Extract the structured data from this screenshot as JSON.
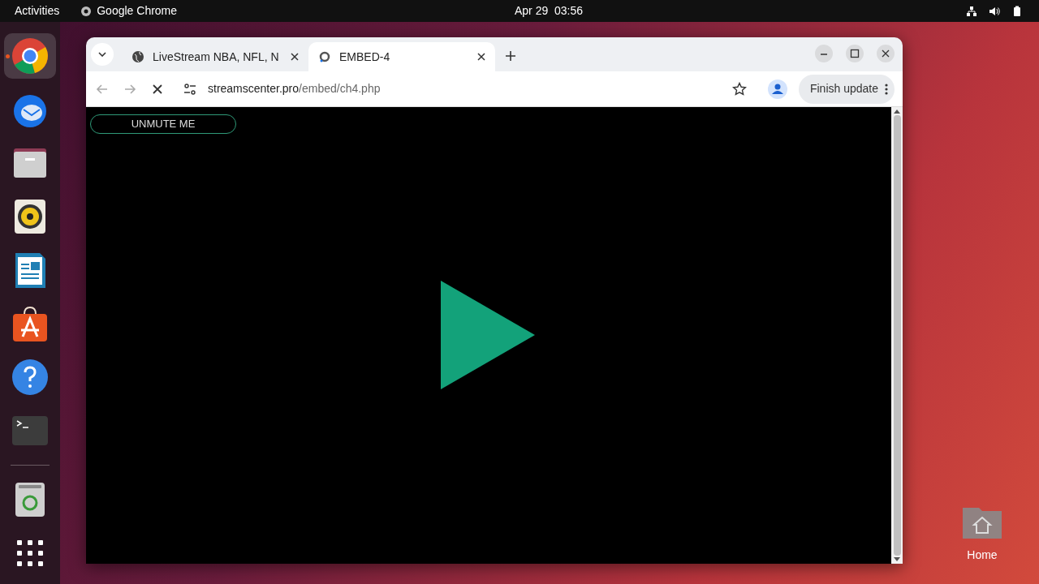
{
  "top_bar": {
    "activities": "Activities",
    "app_name": "Google Chrome",
    "clock": "Apr 29  03:56"
  },
  "dock": {
    "items": [
      {
        "kind": "chrome",
        "selected": true,
        "running": true
      },
      {
        "kind": "thunderbird",
        "selected": false,
        "running": false
      },
      {
        "kind": "files",
        "selected": false,
        "running": false
      },
      {
        "kind": "rhythmbox",
        "selected": false,
        "running": false
      },
      {
        "kind": "writer",
        "selected": false,
        "running": false
      },
      {
        "kind": "software",
        "selected": false,
        "running": false
      },
      {
        "kind": "help",
        "selected": false,
        "running": false
      },
      {
        "kind": "terminal",
        "selected": false,
        "running": false
      },
      {
        "kind": "separator"
      },
      {
        "kind": "trash",
        "selected": false,
        "running": false
      },
      {
        "kind": "apps",
        "selected": false,
        "running": false
      }
    ]
  },
  "browser": {
    "tabs": [
      {
        "title": "LiveStream NBA, NFL, N",
        "kind": "globe",
        "selected": false
      },
      {
        "title": "EMBED-4",
        "kind": "loading",
        "selected": true
      }
    ],
    "address": {
      "host": "streamscenter.pro",
      "path": "/embed/ch4.php"
    },
    "update_button": "Finish update",
    "page": {
      "unmute_button": "UNMUTE ME"
    }
  },
  "desktop_icons": [
    {
      "label": "Home"
    }
  ]
}
